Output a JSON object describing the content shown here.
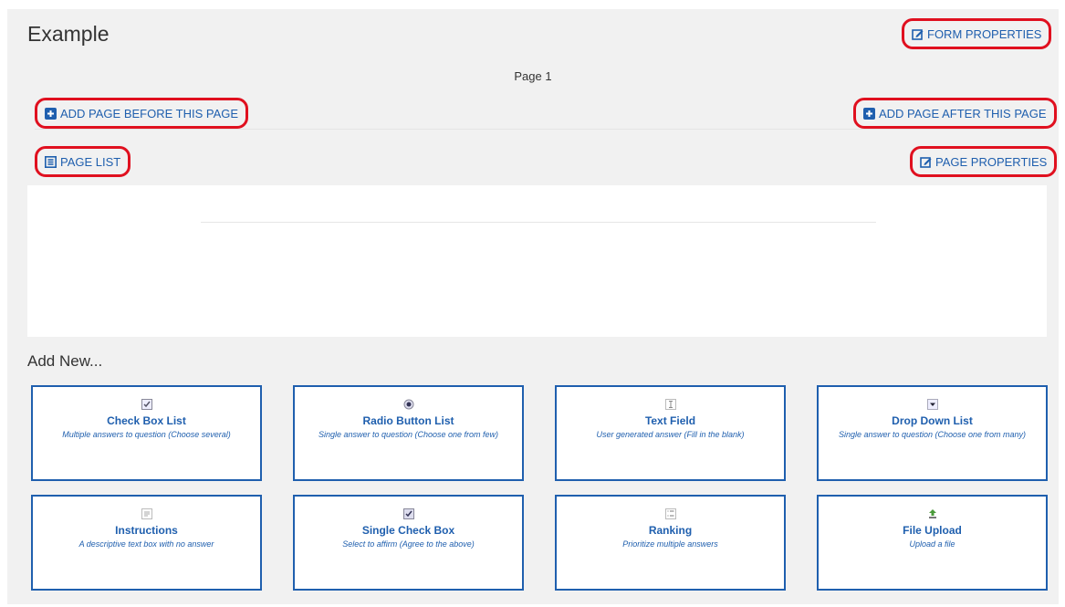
{
  "form": {
    "title": "Example"
  },
  "buttons": {
    "form_properties": "FORM PROPERTIES",
    "add_before": "ADD PAGE BEFORE THIS PAGE",
    "add_after": "ADD PAGE AFTER THIS PAGE",
    "page_list": "PAGE LIST",
    "page_properties": "PAGE PROPERTIES"
  },
  "page": {
    "label": "Page 1"
  },
  "add_new": {
    "heading": "Add New...",
    "tiles": [
      {
        "icon": "checkbox-list-icon",
        "title": "Check Box List",
        "desc": "Multiple answers to question (Choose several)"
      },
      {
        "icon": "radio-icon",
        "title": "Radio Button List",
        "desc": "Single answer to question (Choose one from few)"
      },
      {
        "icon": "text-cursor-icon",
        "title": "Text Field",
        "desc": "User generated answer (Fill in the blank)"
      },
      {
        "icon": "dropdown-icon",
        "title": "Drop Down List",
        "desc": "Single answer to question (Choose one from many)"
      },
      {
        "icon": "instructions-icon",
        "title": "Instructions",
        "desc": "A descriptive text box with no answer"
      },
      {
        "icon": "checkbox-icon",
        "title": "Single Check Box",
        "desc": "Select to affirm (Agree to the above)"
      },
      {
        "icon": "ranking-icon",
        "title": "Ranking",
        "desc": "Prioritize multiple answers"
      },
      {
        "icon": "upload-icon",
        "title": "File Upload",
        "desc": "Upload a file"
      }
    ]
  },
  "colors": {
    "accent": "#1f5fae",
    "highlight": "#e0101f",
    "panel": "#f1f1f1"
  }
}
